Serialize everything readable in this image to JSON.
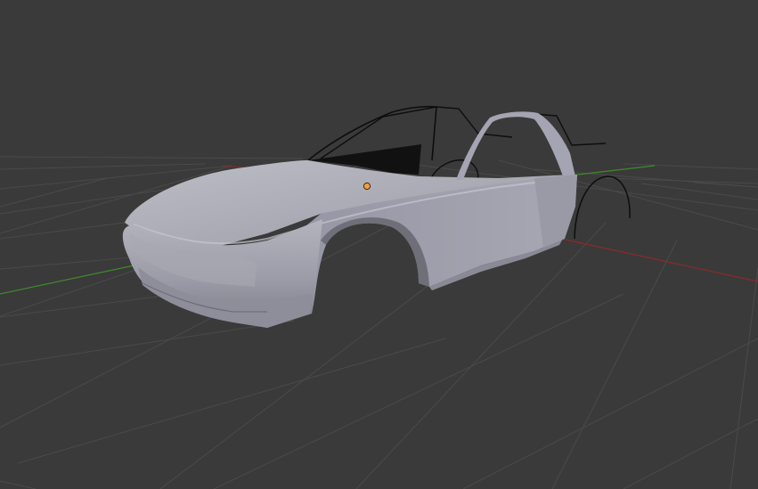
{
  "viewport": {
    "background_color": "#3a3a3a",
    "grid_color": "#4a4a4a",
    "x_axis_color": "#8c2a2a",
    "y_axis_color": "#3f8a2a",
    "object": {
      "kind": "car-body-mesh",
      "body_color": "#a4a4b0",
      "shadow_color": "#76767f",
      "highlight_color": "#c4c4cc",
      "wire_color": "#0d0d0d",
      "origin_color": "#f0a03c"
    }
  }
}
